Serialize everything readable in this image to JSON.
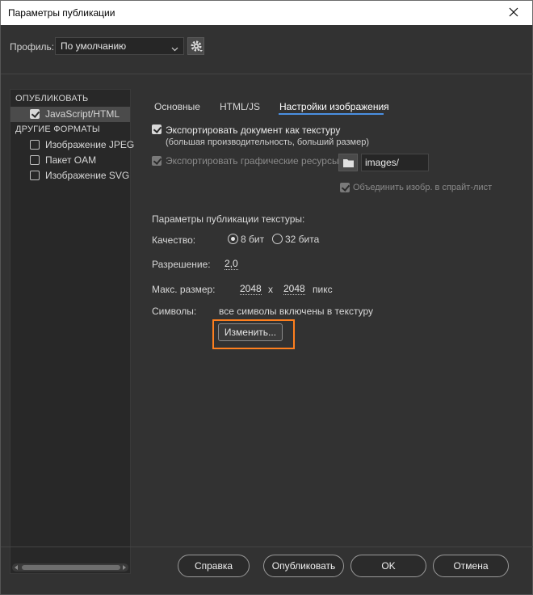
{
  "window": {
    "title": "Параметры публикации"
  },
  "profile": {
    "label": "Профиль:",
    "value": "По умолчанию"
  },
  "left_panel": {
    "publish_header": "ОПУБЛИКОВАТЬ",
    "publish_items": [
      {
        "label": "JavaScript/HTML",
        "checked": true
      }
    ],
    "other_header": "ДРУГИЕ ФОРМАТЫ",
    "other_items": [
      {
        "label": "Изображение JPEG",
        "checked": false
      },
      {
        "label": "Пакет OAM",
        "checked": false
      },
      {
        "label": "Изображение SVG",
        "checked": false
      }
    ]
  },
  "tabs": [
    {
      "label": "Основные",
      "active": false
    },
    {
      "label": "HTML/JS",
      "active": false
    },
    {
      "label": "Настройки изображения",
      "active": true
    }
  ],
  "export_texture": {
    "label": "Экспортировать документ как текстуру",
    "hint": "(большая производительность, больший размер)",
    "checked": true
  },
  "export_assets": {
    "label": "Экспортировать графические ресурсы:",
    "checked": true,
    "disabled": true,
    "path": "images/"
  },
  "spritesheet": {
    "label": "Объединить изобр. в спрайт-лист",
    "checked": true,
    "disabled": true
  },
  "texture": {
    "section_title": "Параметры публикации текстуры:",
    "quality_label": "Качество:",
    "quality_options": [
      {
        "label": "8 бит",
        "selected": true
      },
      {
        "label": "32 бита",
        "selected": false
      }
    ],
    "resolution_label": "Разрешение:",
    "resolution_value": "2,0",
    "max_size_label": "Макс. размер:",
    "max_width": "2048",
    "times": "x",
    "max_height": "2048",
    "unit": "пикс",
    "symbols_label": "Символы:",
    "symbols_value": "все символы включены в текстуру",
    "edit_button": "Изменить..."
  },
  "footer": {
    "help": "Справка",
    "publish": "Опубликовать",
    "ok": "OK",
    "cancel": "Отмена"
  },
  "colors": {
    "background": "#323232",
    "accent_tab": "#4a90e2",
    "highlight": "#ff7f1e"
  }
}
